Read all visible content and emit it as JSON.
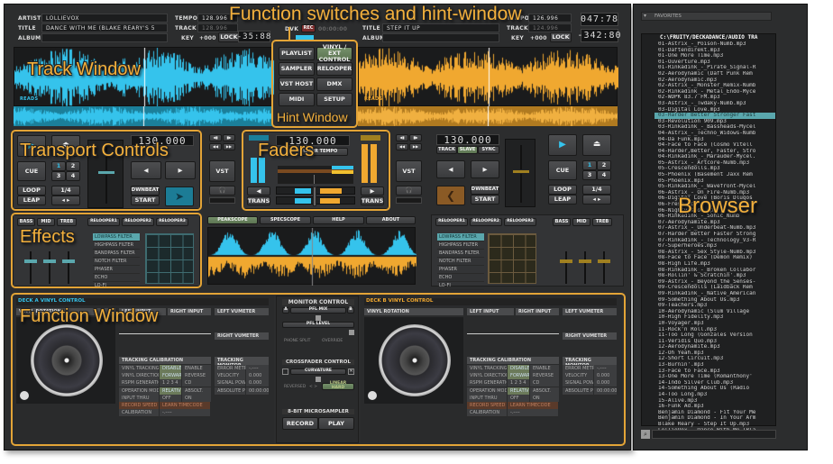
{
  "deck_a": {
    "artist_label": "ARTIST",
    "artist": "LOLLIEVOX",
    "title_label": "TITLE",
    "title": "DANCE WITH ME (BLAKE REARY'S 5",
    "album_label": "ALBUM",
    "album": "",
    "tempo_label": "TEMPO",
    "tempo": "128.996",
    "track_label": "TRACK",
    "track_tempo": "128.996",
    "key_label": "KEY",
    "key": "+000",
    "lock": "LOCK",
    "time": "-35:88",
    "bpm": "130.000",
    "cue": "CUE",
    "loop": "LOOP",
    "leap": "LEAP",
    "loop_size": "1/4",
    "hotcues": [
      "1",
      "2",
      "3",
      "4"
    ],
    "downbeat": "DWNBEAT",
    "start": "START",
    "vst": "VST",
    "trans": "TRANS",
    "marker": "READS"
  },
  "deck_b": {
    "title_label": "TITLE",
    "title": "STEP IT UP",
    "album_label": "ALBUM",
    "album": "",
    "tempo_label": "TEMPO",
    "tempo": "126.996",
    "track_label": "TRACK",
    "track_tempo": "124.996",
    "key_label": "KEY",
    "key": "+000",
    "lock": "LOCK",
    "time_elapsed": "047:78",
    "time_remaining": "-342:80",
    "bpm": "130.000",
    "sync_buttons": [
      "TRACK",
      "SLAVE",
      "SYNC"
    ],
    "cue": "CUE",
    "loop": "LOOP",
    "leap": "LEAP",
    "loop_size": "1/4",
    "hotcues": [
      "1",
      "2",
      "3",
      "4"
    ],
    "downbeat": "DWNBEAT",
    "start": "START",
    "vst": "VST",
    "trans": "TRANS",
    "marker": "READS"
  },
  "center": {
    "dvk": "DVK",
    "rec": "REC",
    "rec_time": "00:00:00",
    "master_bpm": "130.000",
    "master_tempo": "MASTER TEMPO",
    "switches": [
      "PLAYLIST",
      "VINYL / EXT CONTROL",
      "SAMPLER",
      "RELOOPER",
      "VST HOST",
      "DMX",
      "MIDI",
      "SETUP"
    ]
  },
  "effects": {
    "eq": [
      "BASS",
      "MID",
      "TREB"
    ],
    "reloopers": [
      "RELOOPER1",
      "RELOOPER2",
      "RELOOPER3"
    ],
    "filters": [
      "LOWPASS FILTER",
      "HIGHPASS FILTER",
      "BANDPASS FILTER",
      "NOTCH FILTER",
      "PHASER",
      "ECHO",
      "LO-FI"
    ]
  },
  "scope_tabs": [
    "PEAKSCOPE",
    "SPECSCOPE",
    "HELP",
    "ABOUT"
  ],
  "vinyl_a": {
    "header": "DECK A VINYL CONTROL"
  },
  "vinyl_b": {
    "header": "DECK B VINYL CONTROL"
  },
  "vinyl": {
    "rotation": "VINYL ROTATION",
    "left_input": "LEFT INPUT",
    "right_input": "RIGHT INPUT",
    "left_vu": "LEFT VUMETER",
    "right_vu": "RIGHT VUMETER",
    "calib": "TRACKING CALIBRATION",
    "monitor": "TRACKING MONITOR",
    "calib_rows": [
      [
        "VINYL TRACKING",
        "DISABLE",
        "ENABLE"
      ],
      [
        "VINYL DIRECTION",
        "FORWARD",
        "REVERSE"
      ],
      [
        "RSPM GENERATION",
        "1  2  3  4",
        "CD"
      ],
      [
        "OPERATION MODE",
        "RELATIV",
        "ABSOLT."
      ],
      [
        "INPUT THRU",
        "OFF",
        "ON"
      ],
      [
        "RECORD SPEED",
        "LEARN TIMECODE",
        ""
      ],
      [
        "CALIBRATION",
        "-.----",
        ""
      ]
    ],
    "monitor_rows": [
      [
        "ERROR METRIC",
        "-.----"
      ],
      [
        "VELOCITY",
        "0.000"
      ],
      [
        "SIGNAL POWER",
        "0.000"
      ],
      [
        "ABSOLUTE POS",
        "00:00:00"
      ]
    ]
  },
  "monitor": {
    "title": "MONITOR CONTROL",
    "a": "A",
    "pfl_mix": "PFL MIX",
    "b": "B",
    "pfl_level": "PFL LEVEL",
    "phone_split": "PHONE SPLIT",
    "override": "OVERRIDE"
  },
  "crossfader": {
    "title": "CROSSFADER CONTROL",
    "curvature": "CURVATURE",
    "reversed": "REVERSED",
    "arrows": "< >",
    "linear": "LINEAR HARD"
  },
  "sampler": {
    "title": "8-BIT MICROSAMPLER",
    "record": "RECORD",
    "play": "PLAY"
  },
  "browser": {
    "favorites": "FAVORITES",
    "path": "C:\\FRUITY/DECKADANCE/AUDIO TRA",
    "selected_index": 12,
    "files": [
      "01-Astrix_-_Poison-Numb.mp3",
      "01-Daftendirekt.mp3",
      "01-One More Time.mp3",
      "01-Ouverture.mp3",
      "01-Rinkadink_-_Pirate_Signal-R",
      "02-Aerodynamic  (Daft Punk Rem",
      "02-Aerodynamic.mp3",
      "02-Astrix_-_Monster_Remix-Numb",
      "02-Rinkadink_-_Metal_Endo-Myce",
      "02-WDPK 83.7 FM.mp3",
      "03-Astrix_-_Twdaky-Numb.mp3",
      "03-Digital Love.mp3",
      "03-Harder Better Stronger Fast",
      "03-Revolution 909.mp3",
      "03-Rinkadink_-_Bassheads-Mycel",
      "04-Astrix_-_Techno_Widows-Numb",
      "04-Da Funk.mp3",
      "04-Face to Face  (Cosmo Vitell",
      "04-Harder,Better, Faster, Stro",
      "04-Rinkadink_-_Marauder-Mycel.",
      "05-Astrix_-_Artcore-Numb.mp3",
      "05-Crescendolls.mp3",
      "05-Phoenix  (Basement Jaxx Rem",
      "05-Phoenix.mp3",
      "05-Rinkadink_-_Wavefront-Mycel",
      "06-Astrix_-_On_Fire-Numb.mp3",
      "06-Digital Love  (Boris Dlugos",
      "06-Fresh.mp3",
      "06-Nightvision.mp3",
      "06-Rinkadink_-_Sonic_Numb",
      "07-Aerodynamite.mp3",
      "07-Astrix_-_Underbeat-Numb.mp3",
      "07-Harder Better Faster Strong",
      "07-Rinkadink_-_Technology_V3-R",
      "07-Superheroes.mp3",
      "08-Astrix_-_Sex_Style-Numb.mp3",
      "08-Face to Face  (Demon Remix)",
      "08-High Life.mp3",
      "08-Rinkadink_-_Broken_Collabor",
      "08-Rollin' & Scratchin'.mp3",
      "09-Astrix_-_Beyond_the_Senses-",
      "09-Crescendolls  (Laidback Rem",
      "09-Rinkadink_-_Native_American",
      "09-Something About Us.mp3",
      "09-Teachers.mp3",
      "10-Aerodynamic  (Slum Village",
      "10-High Fidelity.mp3",
      "10-Voyager.mp3",
      "11-Rock'n Roll.mp3",
      "11-Too Long  (Gonzales Version",
      "11-Veridis Quo.mp3",
      "12-Aerodynamite.mp3",
      "12-Oh Yeah.mp3",
      "12-Short Circuit.mp3",
      "13-Burnin'.mp3",
      "13-Face to Face.mp3",
      "13-One More Time  (Romanthony'",
      "14-Indo Silver Club.mp3",
      "14-Something About Us  (Radio",
      "14-Too Long.mp3",
      "15-Alive.mp3",
      "16-Funk Ad.mp3",
      "Benjamin Diamond - Fit Your Me",
      "Benjamin Diamond - In Your Arm",
      "Blake Reary - Step It Up.mp3",
      "LollieVox - Dance With Me (Bla"
    ]
  },
  "annotations": {
    "function_switches": "Function switches and hint-window",
    "track_window": "Track Window",
    "hint_window": "Hint Window",
    "transport": "Transport Controls",
    "faders": "Faders",
    "effects": "Effects",
    "function_window": "Function Window",
    "browser": "Browser"
  },
  "colors": {
    "deck_a": "#35c3ec",
    "deck_b": "#f0a830",
    "annotation": "#e3a437",
    "selection": "#5aa7ad"
  }
}
